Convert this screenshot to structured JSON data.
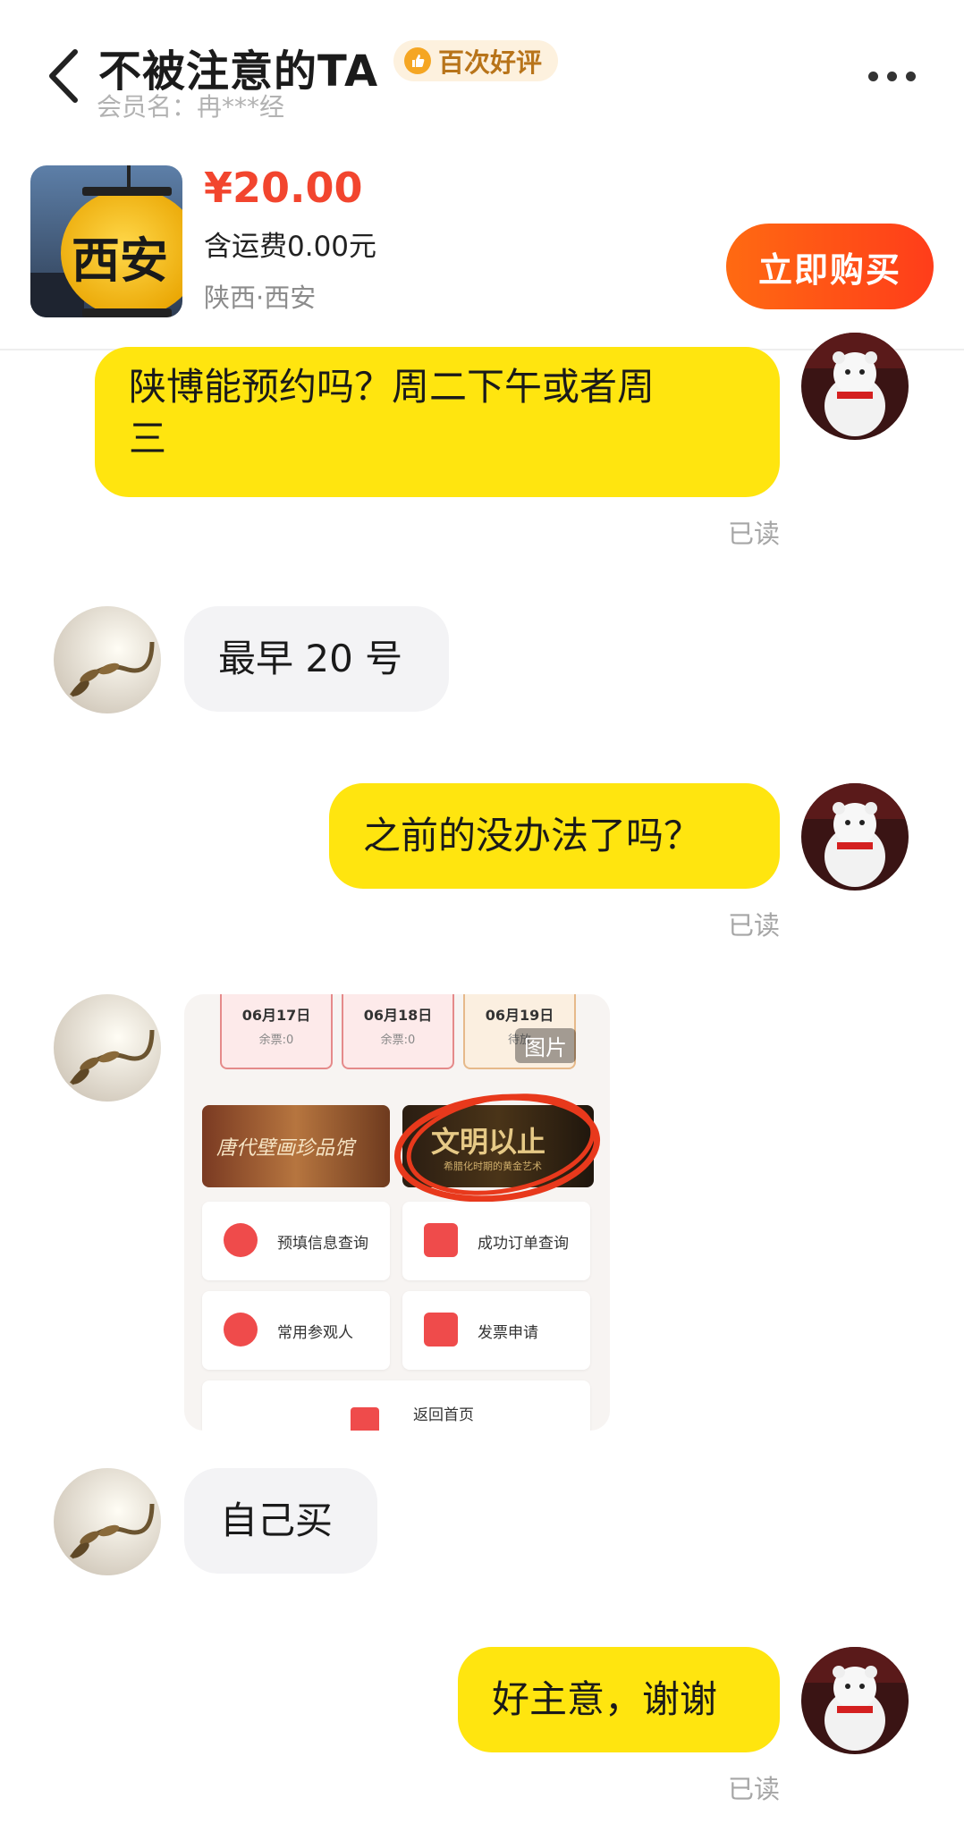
{
  "header": {
    "seller_name": "不被注意的TA",
    "badge": "百次好评",
    "member_label": "会员名：冉***经"
  },
  "product": {
    "price": "¥20.00",
    "shipping": "含运费0.00元",
    "location": "陕西·西安",
    "buy_label": "立即购买",
    "thumb_text": "西安"
  },
  "messages": [
    {
      "from": "me",
      "text_line1": "陕博能预约吗？周二下午或者周",
      "text_line2": "三",
      "status": "已读"
    },
    {
      "from": "seller",
      "text": "最早 20 号"
    },
    {
      "from": "me",
      "text": "之前的没办法了吗？",
      "status": "已读"
    },
    {
      "from": "seller",
      "type": "image",
      "image_tag": "图片"
    },
    {
      "from": "seller",
      "text": "自己买"
    },
    {
      "from": "me",
      "text": "好主意，谢谢",
      "status": "已读"
    }
  ],
  "shared_image": {
    "dates": [
      {
        "date": "06月17日",
        "left": "余票:0"
      },
      {
        "date": "06月18日",
        "left": "余票:0"
      },
      {
        "date": "06月19日",
        "left": "待放"
      }
    ],
    "banner_left": "唐代壁画珍品馆",
    "banner_right": "文明以止",
    "banner_right_sub": "希腊化时期的黄金艺术",
    "menu": [
      "预填信息查询",
      "成功订单查询",
      "常用参观人",
      "发票申请"
    ],
    "home_label": "返回首页"
  }
}
